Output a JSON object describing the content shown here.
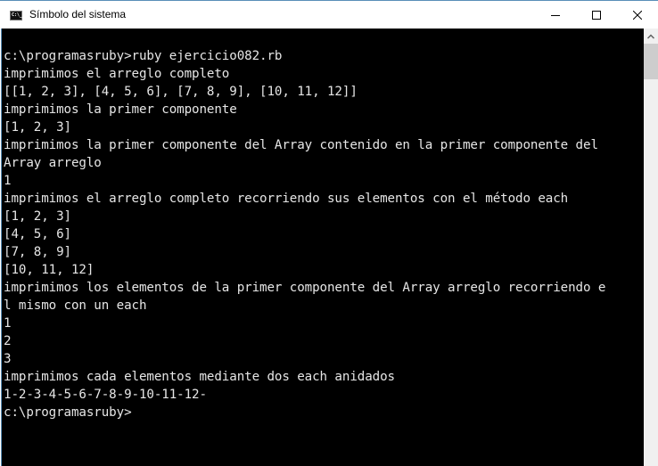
{
  "window": {
    "title": "Símbolo del sistema",
    "app_icon_text": "C:\\_",
    "controls": {
      "minimize": "minimize",
      "maximize": "maximize",
      "close": "close"
    }
  },
  "console": {
    "lines": [
      "c:\\programasruby>ruby ejercicio082.rb",
      "imprimimos el arreglo completo",
      "[[1, 2, 3], [4, 5, 6], [7, 8, 9], [10, 11, 12]]",
      "imprimimos la primer componente",
      "[1, 2, 3]",
      "imprimimos la primer componente del Array contenido en la primer componente del",
      "Array arreglo",
      "1",
      "imprimimos el arreglo completo recorriendo sus elementos con el método each",
      "[1, 2, 3]",
      "[4, 5, 6]",
      "[7, 8, 9]",
      "[10, 11, 12]",
      "imprimimos los elementos de la primer componente del Array arreglo recorriendo e",
      "l mismo con un each",
      "1",
      "2",
      "3",
      "imprimimos cada elementos mediante dos each anidados",
      "1-2-3-4-5-6-7-8-9-10-11-12-",
      "c:\\programasruby>"
    ]
  },
  "scrollbar": {
    "position_fraction": 0.0
  },
  "colors": {
    "console_bg": "#000000",
    "console_fg": "#e6e6e6",
    "window_border": "#5a8fb8"
  }
}
